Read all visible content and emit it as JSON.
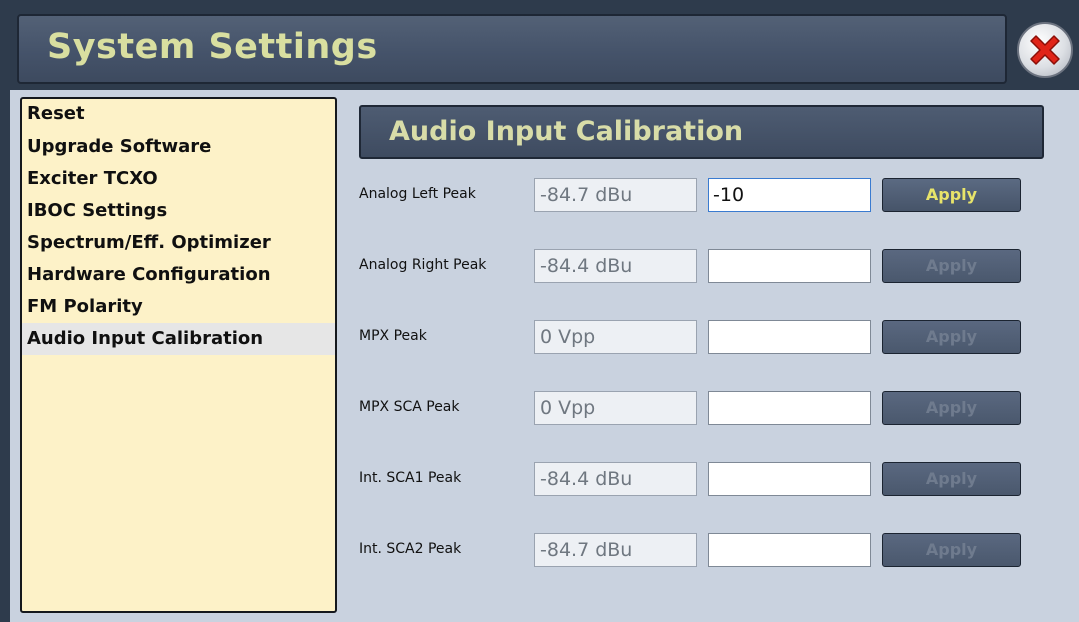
{
  "window": {
    "title": "System Settings",
    "close_icon": "close-icon"
  },
  "sidebar": {
    "items": [
      {
        "label": "Reset",
        "selected": false
      },
      {
        "label": "Upgrade Software",
        "selected": false
      },
      {
        "label": "Exciter TCXO",
        "selected": false
      },
      {
        "label": "IBOC Settings",
        "selected": false
      },
      {
        "label": "Spectrum/Eff. Optimizer",
        "selected": false
      },
      {
        "label": "Hardware Configuration",
        "selected": false
      },
      {
        "label": "FM Polarity",
        "selected": false
      },
      {
        "label": "Audio Input Calibration",
        "selected": true
      }
    ]
  },
  "panel": {
    "title": "Audio Input Calibration",
    "rows": [
      {
        "label": "Analog Left Peak",
        "reading": "-84.7 dBu",
        "input_value": "-10",
        "apply_label": "Apply",
        "apply_enabled": true
      },
      {
        "label": "Analog Right Peak",
        "reading": "-84.4 dBu",
        "input_value": "",
        "apply_label": "Apply",
        "apply_enabled": false
      },
      {
        "label": "MPX Peak",
        "reading": "0 Vpp",
        "input_value": "",
        "apply_label": "Apply",
        "apply_enabled": false
      },
      {
        "label": "MPX SCA Peak",
        "reading": "0 Vpp",
        "input_value": "",
        "apply_label": "Apply",
        "apply_enabled": false
      },
      {
        "label": "Int. SCA1 Peak",
        "reading": "-84.4 dBu",
        "input_value": "",
        "apply_label": "Apply",
        "apply_enabled": false
      },
      {
        "label": "Int. SCA2 Peak",
        "reading": "-84.7 dBu",
        "input_value": "",
        "apply_label": "Apply",
        "apply_enabled": false
      }
    ]
  },
  "colors": {
    "title_text": "#d9dfa0",
    "apply_enabled_text": "#e8e46a",
    "sidebar_bg": "#fdf2c8",
    "panel_bg": "#c9d2df"
  }
}
